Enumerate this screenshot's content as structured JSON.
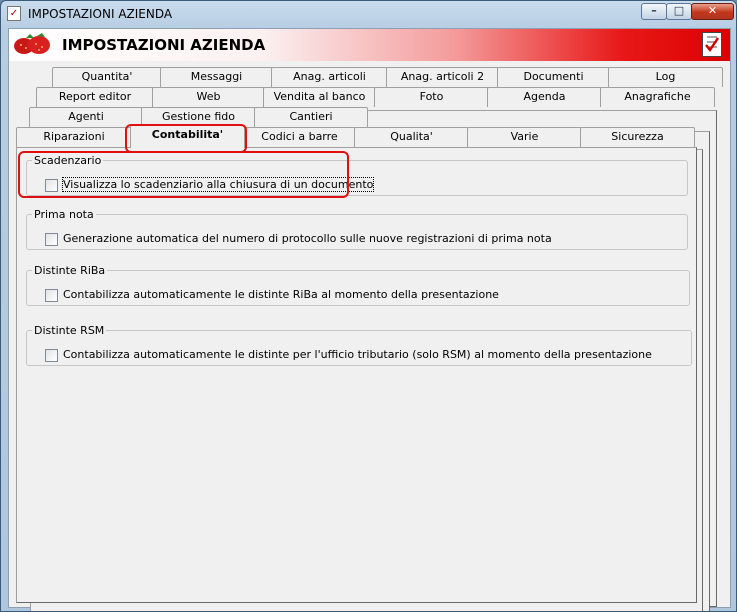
{
  "window": {
    "title": "IMPOSTAZIONI AZIENDA",
    "title_icon": "checklist-icon",
    "buttons": {
      "minimize": "–",
      "maximize": "□",
      "close": "✕"
    }
  },
  "header": {
    "title": "IMPOSTAZIONI AZIENDA",
    "logo": "strawberry-icon",
    "right_icon": "checklist-icon"
  },
  "tabs": {
    "row1": [
      "Quantita'",
      "Messaggi",
      "Anag. articoli",
      "Anag. articoli 2",
      "Documenti",
      "Log"
    ],
    "row2": [
      "Report editor",
      "Web",
      "Vendita al banco",
      "Foto",
      "Agenda",
      "Anagrafiche"
    ],
    "row3": [
      "Agenti",
      "Gestione fido",
      "Cantieri"
    ],
    "row4": [
      "Riparazioni",
      "Contabilita'",
      "Codici a barre",
      "Qualita'",
      "Varie",
      "Sicurezza"
    ],
    "active": "Contabilita'"
  },
  "groups": [
    {
      "title": "Scadenzario",
      "option": "Visualizza lo scadenziario alla chiusura di un documento",
      "checked": false
    },
    {
      "title": "Prima nota",
      "option": "Generazione automatica del numero di protocollo sulle nuove registrazioni di prima nota",
      "checked": false
    },
    {
      "title": "Distinte RiBa",
      "option": "Contabilizza automaticamente le distinte RiBa al momento della presentazione",
      "checked": false
    },
    {
      "title": "Distinte RSM",
      "option": "Contabilizza automaticamente le distinte per l'ufficio tributario (solo RSM) al momento della presentazione",
      "checked": false
    }
  ],
  "colors": {
    "highlight": "#e01010",
    "header_gradient_end": "#dc0000"
  }
}
